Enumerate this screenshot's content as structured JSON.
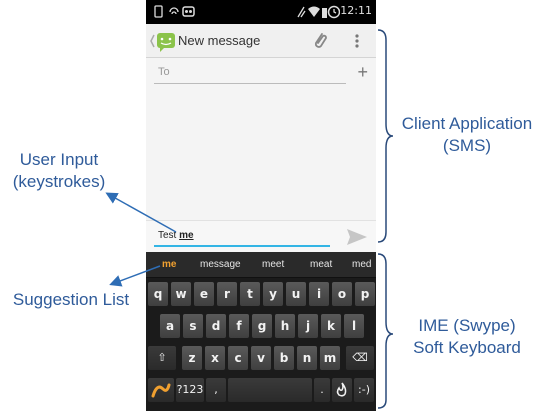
{
  "status_bar": {
    "time": "12:11"
  },
  "app": {
    "title": "New message",
    "to_label": "To",
    "plus_icon": "+",
    "compose_prefix": "Test ",
    "compose_word": "me"
  },
  "keyboard": {
    "suggestions": [
      "me",
      "message",
      "meet",
      "meat",
      "med"
    ],
    "row1": [
      "q",
      "w",
      "e",
      "r",
      "t",
      "y",
      "u",
      "i",
      "o",
      "p"
    ],
    "row2": [
      "a",
      "s",
      "d",
      "f",
      "g",
      "h",
      "j",
      "k",
      "l"
    ],
    "row3": [
      "z",
      "x",
      "c",
      "v",
      "b",
      "n",
      "m"
    ],
    "shift_icon": "⇧",
    "backspace_icon": "⌫",
    "sym_key": "?123",
    "comma_key": ",",
    "period_key": ".",
    "smiley_key": ":-)"
  },
  "annotations": {
    "client_app": [
      "Client Application",
      "(SMS)"
    ],
    "user_input": [
      "User Input",
      "(keystrokes)"
    ],
    "suggestion_list": "Suggestion List",
    "ime": [
      "IME (Swype)",
      "Soft Keyboard"
    ]
  },
  "colors": {
    "annotation_text": "#2f5b9a",
    "arrow": "#2e6db5",
    "suggestion_active": "#f0a030",
    "compose_underline": "#33b5e5",
    "app_icon": "#8bc34a"
  }
}
